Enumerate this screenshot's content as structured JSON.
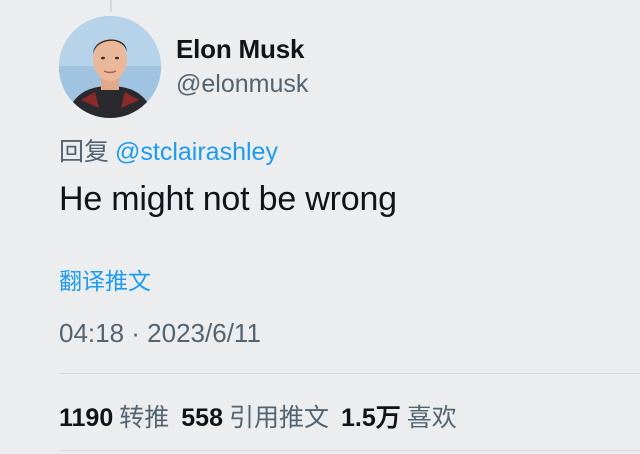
{
  "tweet": {
    "author": {
      "display_name": "Elon Musk",
      "handle": "@elonmusk"
    },
    "reply_prefix": "回复",
    "reply_to": "@stclairashley",
    "text": "He might not be wrong",
    "translate_label": "翻译推文",
    "timestamp": "04:18 · 2023/6/11",
    "stats": {
      "retweets": {
        "count": "1190",
        "label": "转推"
      },
      "quotes": {
        "count": "558",
        "label": "引用推文"
      },
      "likes": {
        "count": "1.5万",
        "label": "喜欢"
      }
    }
  },
  "colors": {
    "background": "#ecedef",
    "link": "#1d9bf0",
    "secondary_text": "#536471",
    "primary_text": "#0f1419"
  }
}
